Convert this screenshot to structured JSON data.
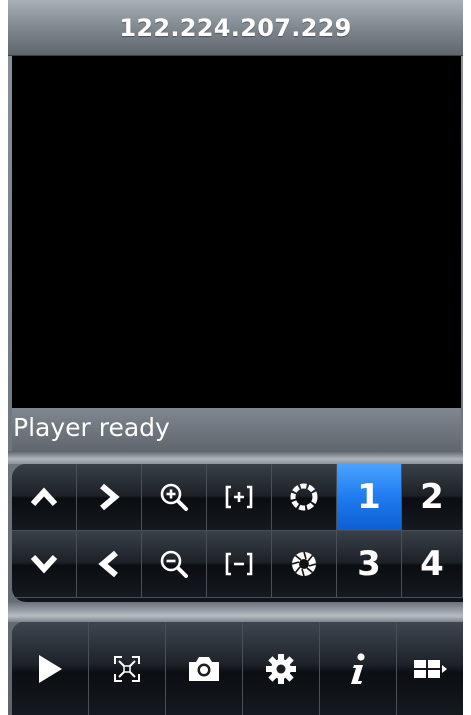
{
  "title": "122.224.207.229",
  "video": {
    "background": "#000000"
  },
  "status": {
    "text": "Player ready"
  },
  "ptz": {
    "row1": [
      {
        "icon": "chevron-up-icon"
      },
      {
        "icon": "chevron-right-icon"
      },
      {
        "icon": "zoom-in-icon"
      },
      {
        "icon": "focus-near-icon"
      },
      {
        "icon": "iris-open-icon"
      },
      {
        "label": "1",
        "active": true
      },
      {
        "label": "2"
      }
    ],
    "row2": [
      {
        "icon": "chevron-down-icon"
      },
      {
        "icon": "chevron-left-icon"
      },
      {
        "icon": "zoom-out-icon"
      },
      {
        "icon": "focus-far-icon"
      },
      {
        "icon": "iris-close-icon"
      },
      {
        "label": "3"
      },
      {
        "label": "4"
      }
    ],
    "accent": "#1f7cf0"
  },
  "actions": [
    {
      "icon": "play-icon"
    },
    {
      "icon": "fullscreen-icon"
    },
    {
      "icon": "camera-icon"
    },
    {
      "icon": "gear-icon"
    },
    {
      "icon": "info-icon"
    },
    {
      "icon": "layout-grid-icon"
    }
  ]
}
